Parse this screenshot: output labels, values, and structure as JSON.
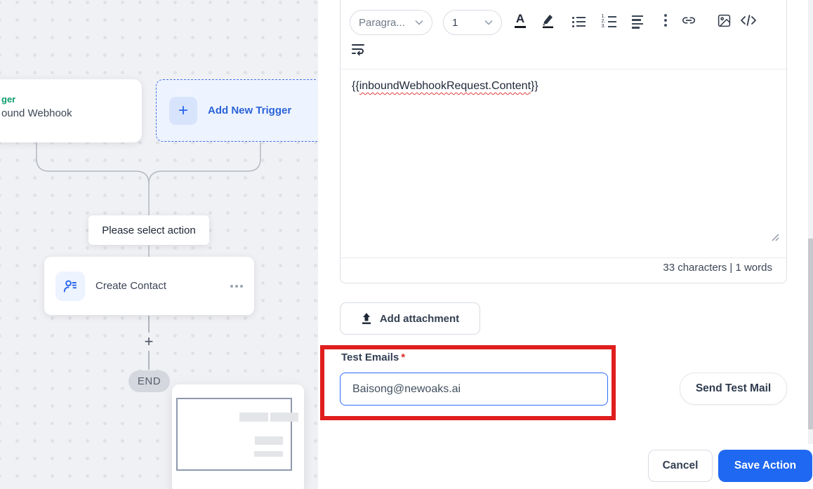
{
  "canvas": {
    "trigger_card": {
      "category_fragment": "ger",
      "title_fragment": "ound Webhook"
    },
    "add_new_trigger": {
      "plus": "+",
      "label": "Add New Trigger"
    },
    "select_action_label": "Please select action",
    "create_contact": {
      "label": "Create Contact"
    },
    "plus_connector": "+",
    "end_label": "END"
  },
  "editor": {
    "toolbar": {
      "paragraph_select": "Paragra...",
      "size_select": "1",
      "icons_row1": [
        "text-color",
        "highlight",
        "bullet-list",
        "ordered-list",
        "align-left",
        "more-options",
        "link",
        "image",
        "code-view"
      ],
      "icons_row2": [
        "text-wrap"
      ]
    },
    "content": {
      "prefix": "{{",
      "token": "inboundWebhookRequest.Content",
      "suffix": "}}"
    },
    "counter": "33 characters | 1 words"
  },
  "attachment": {
    "label": "Add attachment",
    "icon": "upload"
  },
  "test_emails": {
    "label": "Test Emails",
    "required_mark": "*",
    "value": "Baisong@newoaks.ai"
  },
  "actions": {
    "send_test": "Send Test Mail",
    "cancel": "Cancel",
    "save": "Save Action"
  },
  "colors": {
    "primary_blue": "#1f68f1",
    "annotation_red": "#e01e1e",
    "trigger_green": "#0f9d6e",
    "link_blue": "#2a63d8",
    "input_border_blue": "#2f6bff",
    "canvas_bg": "#f0f1f4"
  }
}
